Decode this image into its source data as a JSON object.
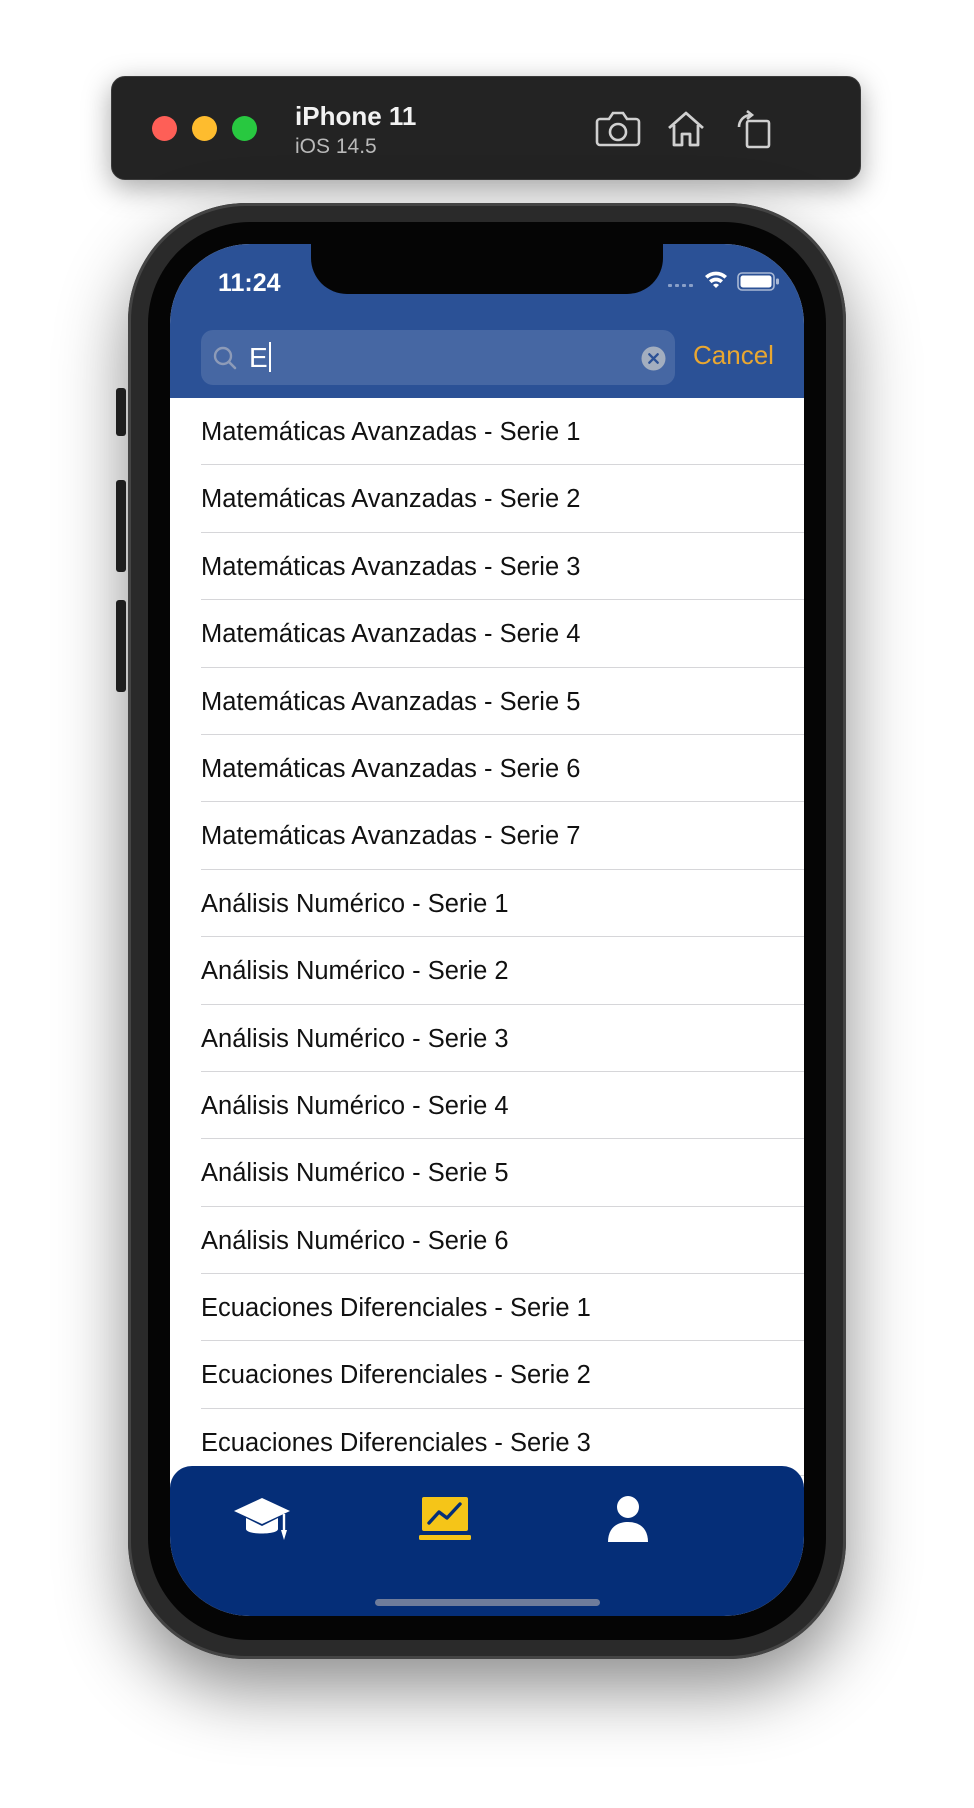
{
  "simulator": {
    "device_name": "iPhone 11",
    "os_version": "iOS 14.5",
    "buttons": [
      {
        "name": "screenshot",
        "icon": "camera-icon"
      },
      {
        "name": "home",
        "icon": "home-icon"
      },
      {
        "name": "rotate",
        "icon": "rotate-icon"
      }
    ]
  },
  "status_bar": {
    "time": "11:24"
  },
  "search": {
    "query": "E",
    "cancel_label": "Cancel"
  },
  "results": [
    "Matemáticas Avanzadas - Serie 1",
    "Matemáticas Avanzadas - Serie 2",
    "Matemáticas Avanzadas - Serie 3",
    "Matemáticas Avanzadas - Serie 4",
    "Matemáticas Avanzadas - Serie 5",
    "Matemáticas Avanzadas - Serie 6",
    "Matemáticas Avanzadas - Serie 7",
    "Análisis Numérico - Serie 1",
    "Análisis Numérico - Serie 2",
    "Análisis Numérico - Serie 3",
    "Análisis Numérico - Serie 4",
    "Análisis Numérico - Serie 5",
    "Análisis Numérico - Serie 6",
    "Ecuaciones Diferenciales - Serie 1",
    "Ecuaciones Diferenciales - Serie 2",
    "Ecuaciones Diferenciales - Serie 3"
  ],
  "tab_bar": {
    "tabs": [
      {
        "icon": "graduation-cap-icon",
        "selected": false
      },
      {
        "icon": "chart-board-icon",
        "selected": true
      },
      {
        "icon": "user-icon",
        "selected": false
      }
    ]
  },
  "colors": {
    "header_bg": "#2b5196",
    "tabbar_bg": "#052e78",
    "accent": "#e9a731",
    "tab_selected": "#f5c518",
    "tab_unselected": "#ffffff"
  }
}
